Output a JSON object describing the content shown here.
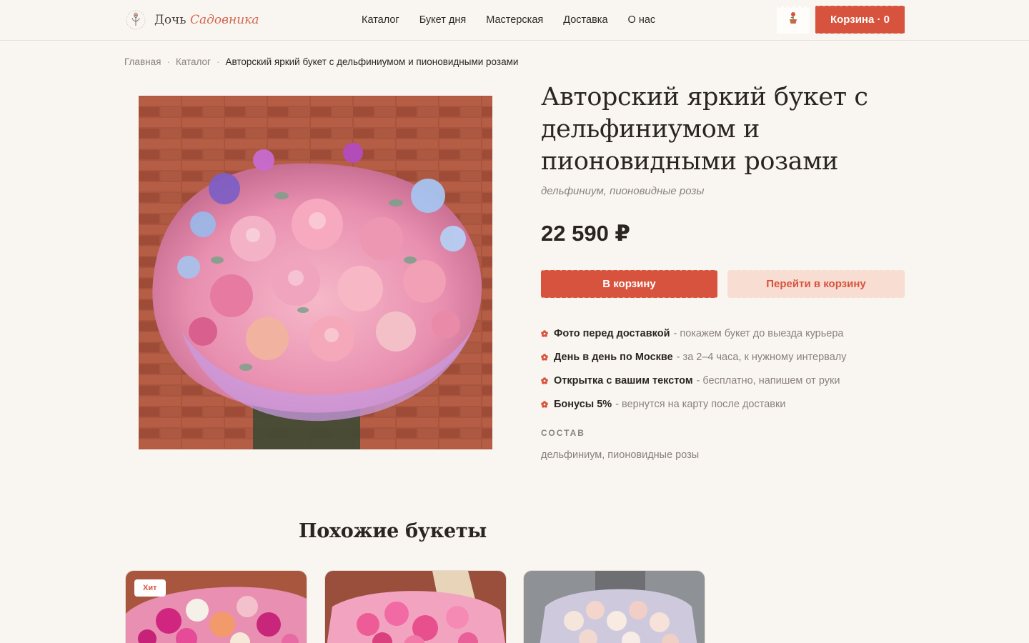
{
  "header": {
    "logo": {
      "brand_main": "Дочь",
      "brand_accent": "Садовника"
    },
    "nav": [
      "Каталог",
      "Букет дня",
      "Мастерская",
      "Доставка",
      "О нас"
    ],
    "cart_label": "Корзина · 0",
    "colors": {
      "accent": "#d8533d",
      "background": "#f9f6f1"
    }
  },
  "breadcrumb": {
    "home": "Главная",
    "catalog": "Каталог",
    "current": "Авторский яркий букет с дельфиниумом и пионовидными розами",
    "separator": "·"
  },
  "product": {
    "title": "Авторский яркий букет с дельфиниумом и пионовидными розами",
    "subtitle": "дельфиниум, пионовидные розы",
    "price": "22 590 ₽",
    "add_to_cart": "В корзину",
    "go_to_cart": "Перейти в корзину",
    "features": [
      {
        "bold": "Фото перед доставкой",
        "text": "- покажем букет до выезда курьера"
      },
      {
        "bold": "День в день по Москве",
        "text": "- за 2–4 часа, к нужному интервалу"
      },
      {
        "bold": "Открытка с вашим текстом",
        "text": "- бесплатно, напишем от руки"
      },
      {
        "bold": "Бонусы 5%",
        "text": "- вернутся на карту после доставки"
      }
    ],
    "composition_label": "СОСТАВ",
    "composition_value": "дельфиниум, пионовидные розы"
  },
  "similar": {
    "title": "Похожие букеты",
    "cards": [
      {
        "badge": "Хит"
      },
      {
        "badge": ""
      },
      {
        "badge": ""
      }
    ]
  }
}
